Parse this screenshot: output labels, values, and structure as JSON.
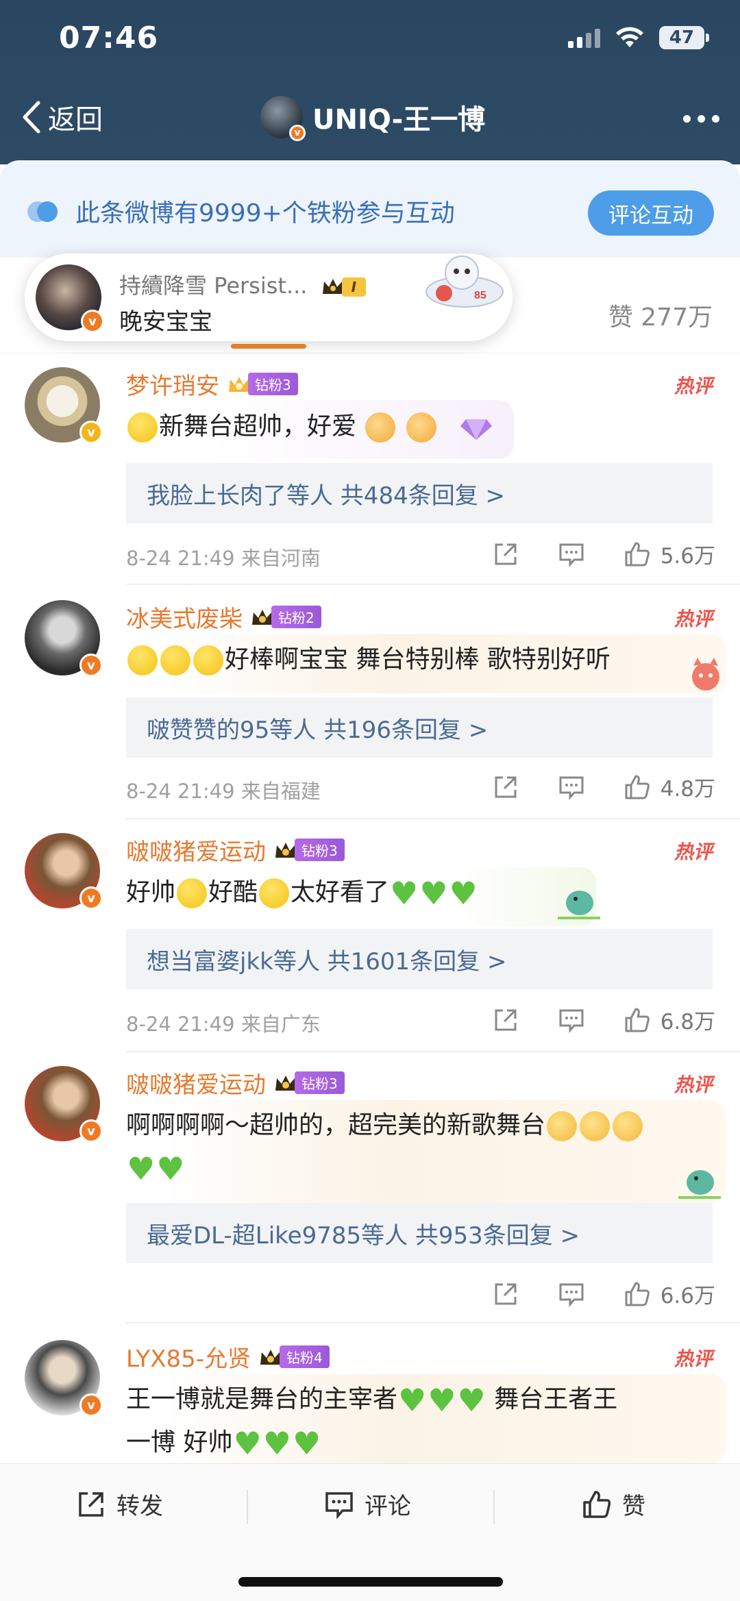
{
  "status_bar": {
    "time": "07:46",
    "battery": "47"
  },
  "nav": {
    "back_label": "返回",
    "title": "UNIQ-王一博"
  },
  "fan_banner": {
    "text": "此条微博有9999+个铁粉参与互动",
    "button": "评论互动"
  },
  "tabs": {
    "likes_total": "赞 277万"
  },
  "popup": {
    "name": "持續降雪 Persist...",
    "badge_level": "I",
    "message": "晚安宝宝"
  },
  "comments": [
    {
      "name": "梦许琑安",
      "badge": "钻粉3",
      "hot": "热评",
      "text_before": "",
      "text": "新舞台超帅，好爱",
      "reply": "我脸上长肉了等人  共484条回复 >",
      "meta": "8-24 21:49  来自河南",
      "likes": "5.6万"
    },
    {
      "name": "冰美式废柴",
      "badge": "钻粉2",
      "hot": "热评",
      "text": "好棒啊宝宝 舞台特别棒 歌特别好听",
      "reply": "啵赞赞的95等人  共196条回复 >",
      "meta": "8-24 21:49  来自福建",
      "likes": "4.8万"
    },
    {
      "name": "啵啵猪爱运动",
      "badge": "钻粉3",
      "hot": "热评",
      "text_a": "好帅",
      "text_b": "好酷",
      "text_c": "太好看了",
      "reply": "想当富婆jkk等人  共1601条回复 >",
      "meta": "8-24 21:49  来自广东",
      "likes": "6.8万"
    },
    {
      "name": "啵啵猪爱运动",
      "badge": "钻粉3",
      "hot": "热评",
      "text": "啊啊啊啊～超帅的，超完美的新歌舞台",
      "reply": "最爱DL-超Like9785等人  共953条回复 >",
      "likes": "6.6万"
    },
    {
      "name": "LYX85-允贤",
      "badge": "钻粉4",
      "hot": "热评",
      "text_line1": "王一博就是舞台的主宰者",
      "text_line1b": "舞台王者王",
      "text_line2": "一博 好帅"
    }
  ],
  "bottom_bar": {
    "repost": "转发",
    "comment": "评论",
    "like": "赞"
  }
}
